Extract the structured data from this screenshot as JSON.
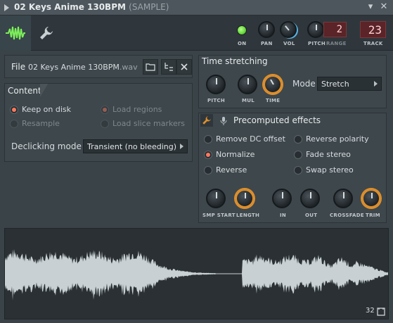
{
  "window": {
    "title": "02 Keys Anime 130BPM",
    "subtitle": "(SAMPLE)",
    "buttons": {
      "menu": "▾",
      "close": "✕"
    }
  },
  "toolbar": {
    "tabs": [
      {
        "icon": "waveform-icon",
        "active": true
      },
      {
        "icon": "wrench-icon",
        "active": false
      }
    ],
    "on_label": "ON",
    "pan_label": "PAN",
    "vol_label": "VOL",
    "pitch_label": "PITCH",
    "range_label": "RANGE",
    "range_value": "2",
    "track_label": "TRACK",
    "track_value": "23"
  },
  "file": {
    "label": "File",
    "filename": "02 Keys Anime 130BPM",
    "extension": ".wav",
    "open_icon": "folder-icon",
    "locate_icon": "tree-locate-icon",
    "close_icon": "close-icon"
  },
  "content": {
    "heading": "Content",
    "keep_on_disk": "Keep on disk",
    "resample": "Resample",
    "load_regions": "Load regions",
    "load_slice_markers": "Load slice markers",
    "declicking_label": "Declicking mode",
    "declicking_value": "Transient (no bleeding)"
  },
  "time_stretching": {
    "heading": "Time stretching",
    "pitch_label": "PITCH",
    "mul_label": "MUL",
    "time_label": "TIME",
    "mode_label": "Mode",
    "mode_value": "Stretch"
  },
  "precomputed": {
    "heading": "Precomputed effects",
    "remove_dc": "Remove DC offset",
    "normalize": "Normalize",
    "reverse": "Reverse",
    "reverse_polarity": "Reverse polarity",
    "fade_stereo": "Fade stereo",
    "swap_stereo": "Swap stereo",
    "knobs": {
      "smp_start": "SMP START",
      "length": "LENGTH",
      "in": "IN",
      "out": "OUT",
      "crossfade": "CROSSFADE",
      "trim": "TRIM"
    }
  },
  "waveform": {
    "zoom_value": "32"
  },
  "colors": {
    "accent_orange": "#e0902c",
    "radio_on": "#ff7a5c",
    "led_green": "#66d63a",
    "lcd_red": "#5a2428",
    "wave_fill": "#c8d0d4"
  }
}
